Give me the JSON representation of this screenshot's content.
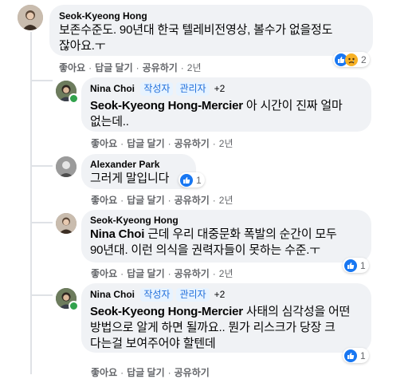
{
  "actions": {
    "like": "좋아요",
    "reply": "답글 달기",
    "share": "공유하기",
    "separator": "·"
  },
  "comments": [
    {
      "author": "Seok-Kyeong Hong",
      "text_line1": "보존수준도. 90년대 한국 텔레비전영상, 볼수가 없을정도",
      "text_line2": "잖아요.ㅜ",
      "time": "2년",
      "reactions": [
        "like-icon",
        "sad-icon"
      ],
      "reaction_count": "2"
    },
    {
      "author": "Nina Choi",
      "badges": [
        "작성자",
        "관리자",
        "+2"
      ],
      "mention": "Seok-Kyeong Hong-Mercier",
      "text_line1_rest": " 아 시간이 진짜 얼마",
      "text_line2": "없는데..",
      "time": "2년"
    },
    {
      "author": "Alexander Park",
      "text": "그러게 말입니다",
      "time": "2년",
      "reactions": [
        "like-icon"
      ],
      "reaction_count": "1"
    },
    {
      "author": "Seok-Kyeong Hong",
      "mention": "Nina Choi",
      "text_line1_rest": " 근데 우리 대중문화 폭발의 순간이 모두",
      "text_line2": "90년대. 이런 의식을 권력자들이 못하는 수준.ㅜ",
      "time": "2년",
      "reactions": [
        "like-icon"
      ],
      "reaction_count": "1"
    },
    {
      "author": "Nina Choi",
      "badges": [
        "작성자",
        "관리자",
        "+2"
      ],
      "mention": "Seok-Kyeong Hong-Mercier",
      "text_line1_rest": " 사태의 심각성을 어떤",
      "text_line2": "방법으로 알게 하면 될까요.. 뭔가 리스크가 당장 크",
      "text_line3": "다는걸 보여주어야 할텐데",
      "reactions": [
        "like-icon"
      ],
      "reaction_count": "1"
    }
  ],
  "colors": {
    "bubble": "#f0f2f5",
    "meta": "#65676b",
    "like": "#1877f2",
    "badge_text": "#216fdb",
    "online": "#31a24c"
  }
}
